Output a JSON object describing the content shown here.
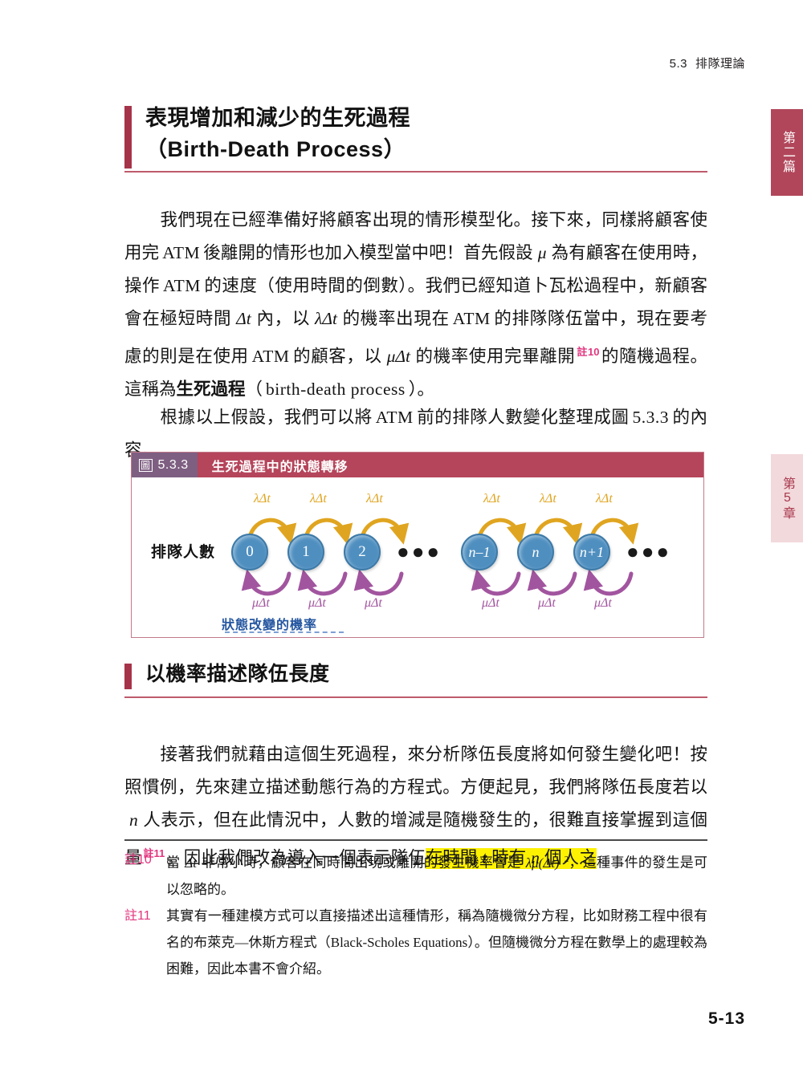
{
  "running_header": {
    "number": "5.3",
    "title": "排隊理論"
  },
  "thumb_tabs": [
    {
      "label": "第二篇",
      "bg": "#b1465a",
      "fg": "#ffffff"
    },
    {
      "label": "第5章",
      "bg": "#f2d9dc",
      "fg": "#a8384c"
    }
  ],
  "headings": {
    "h1_line1": "表現增加和減少的生死過程",
    "h1_line2": "（Birth-Death Process）",
    "h2": "以機率描述隊伍長度"
  },
  "paragraphs": {
    "p1": {
      "seg1": "我們現在已經準備好將顧客出現的情形模型化。接下來，同樣將顧客使用完",
      "atm1": "ATM",
      "seg2": "後離開的情形也加入模型當中吧！首先假設",
      "mu1": "μ",
      "seg3": "為有顧客在使用時，操作",
      "atm2": "ATM",
      "seg4": "的速度（使用時間的倒數）。我們已經知道卜瓦松過程中，新顧客會在極短時間",
      "dt1": "Δt",
      "seg5": "內，以",
      "lamdt": "λΔt",
      "seg6": "的機率出現在",
      "atm3": "ATM",
      "seg7": "的排隊隊伍當中，現在要考慮的則是在使用",
      "atm4": "ATM",
      "seg8": "的顧客，以",
      "mudt": "μΔt",
      "seg9": "的機率使用完畢離開",
      "fnref": "註10",
      "seg10": "的隨機過程。這稱為",
      "term": "生死過程",
      "seg11": "（",
      "term_en": "birth-death process",
      "seg12": "）。"
    },
    "p2": {
      "seg1": "根據以上假設，我們可以將",
      "atm": "ATM",
      "seg2": "前的排隊人數變化整理成圖",
      "figref": "5.3.3",
      "seg3": "的內容。"
    },
    "p3": {
      "seg1": "接著我們就藉由這個生死過程，來分析隊伍長度將如何發生變化吧！按照慣例，先來建立描述動態行為的方程式。方便起見，我們將隊伍長度若以",
      "n1": "n",
      "seg2": "人表示，但在此情況中，人數的增減是隨機發生的，很難直接掌握到這個量",
      "fnref": "註11",
      "seg3": "。因此我們改為導入一個表示隊伍",
      "hl_seg1": "在時間",
      "hl_t": "t",
      "hl_seg2": "時有",
      "hl_n": "n",
      "hl_seg3": "個人之"
    }
  },
  "figure": {
    "tag_word": "圖",
    "tag_number": "5.3.3",
    "title": "生死過程中的狀態轉移",
    "axis_label": "排隊人數",
    "nodes": [
      "0",
      "1",
      "2",
      "n–1",
      "n",
      "n+1"
    ],
    "ellipsis_glyph": "●●●",
    "up_rate": "λΔt",
    "down_rate": "μΔt",
    "up_rate_count": 6,
    "down_rate_count": 6,
    "legend": "狀態改變的機率",
    "colors": {
      "header_bg": "#b5455b",
      "tag_bg": "#7e5f82",
      "node_fill": "#4f8fc0",
      "up_arrow": "#e0a520",
      "down_arrow": "#a2559f",
      "legend_text": "#2456a0",
      "border": "#c3798a"
    }
  },
  "footnotes": [
    {
      "mark": "註10",
      "seg1": "當",
      "dt": "Δt",
      "seg2": "非常小時，顧客在同時間出現或離開的發生機率會是",
      "formula_base": "λμ(Δt)",
      "formula_sup": "2",
      "seg3": "，這種事件的發生是可以忽略的。"
    },
    {
      "mark": "註11",
      "seg1": "其實有一種建模方式可以直接描述出這種情形，稱為隨機微分方程，比如財務工程中很有名的布萊克—休斯方程式（Black-Scholes Equations）。但隨機微分方程在數學上的處理較為困難，因此本書不會介紹。"
    }
  ],
  "folio": "5-13"
}
